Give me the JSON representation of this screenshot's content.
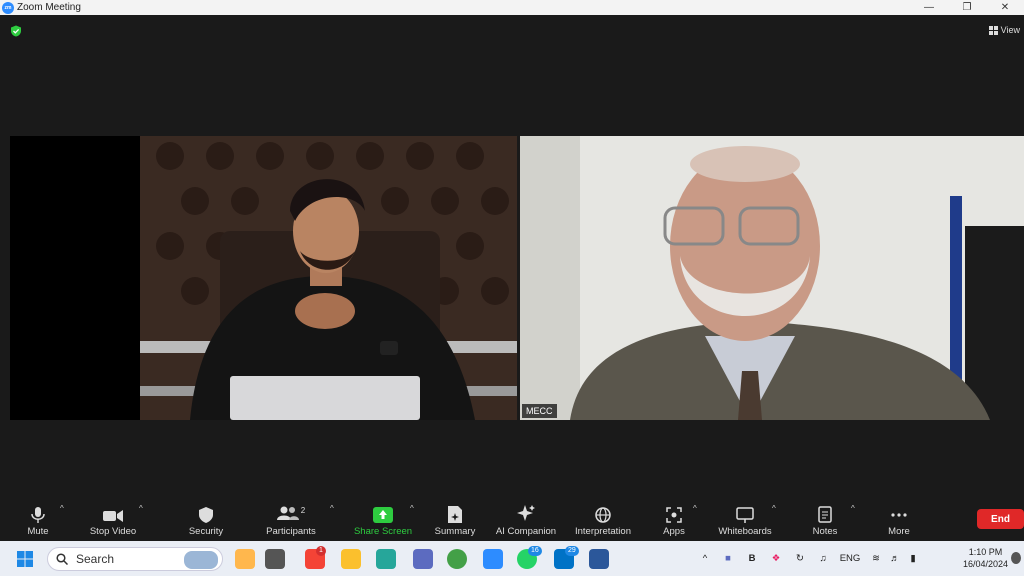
{
  "window": {
    "title": "Zoom Meeting",
    "logo": "zm"
  },
  "header": {
    "view_label": "View"
  },
  "participants": [
    {
      "name": ""
    },
    {
      "name": "MECC"
    }
  ],
  "toolbar": {
    "mute": "Mute",
    "stop_video": "Stop Video",
    "security": "Security",
    "participants": "Participants",
    "participants_count": "2",
    "share_screen": "Share Screen",
    "summary": "Summary",
    "ai_companion": "AI Companion",
    "interpretation": "Interpretation",
    "apps": "Apps",
    "whiteboards": "Whiteboards",
    "notes": "Notes",
    "more": "More",
    "end": "End"
  },
  "taskbar": {
    "search_placeholder": "Search",
    "badges": {
      "msg": "1",
      "whatsapp": "16",
      "outlook": "29"
    },
    "lang": "ENG",
    "time": "1:10 PM",
    "date": "16/04/2024"
  },
  "colors": {
    "share_green": "#2ecc40",
    "end_red": "#e02828",
    "zoom_blue": "#2d8cff"
  }
}
